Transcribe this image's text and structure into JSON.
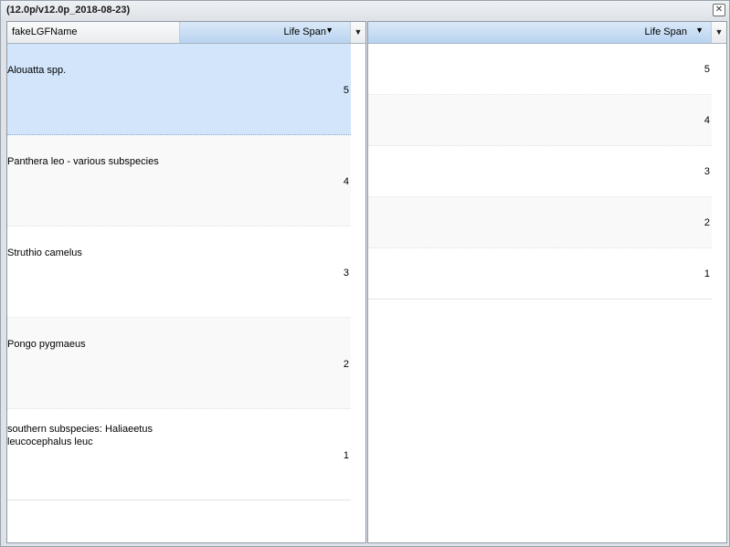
{
  "window": {
    "title": "(12.0p/v12.0p_2018-08-23)"
  },
  "icons": {
    "close": "close-icon",
    "sort": "sort-desc-icon",
    "menu": "dropdown-icon"
  },
  "left_grid": {
    "columns": [
      {
        "label": "fakeLGFName",
        "sorted": false
      },
      {
        "label": "Life Span",
        "sorted": true
      }
    ],
    "rows": [
      {
        "name": "Alouatta spp.",
        "life_span": "5",
        "selected": true
      },
      {
        "name": "Panthera leo - various subspecies",
        "life_span": "4",
        "selected": false
      },
      {
        "name": "Struthio camelus",
        "life_span": "3",
        "selected": false
      },
      {
        "name": "Pongo pygmaeus",
        "life_span": "2",
        "selected": false
      },
      {
        "name": "southern subspecies: Haliaeetus leucocephalus leuc",
        "life_span": "1",
        "selected": false
      }
    ]
  },
  "right_grid": {
    "columns": [
      {
        "label": "Life Span",
        "sorted": true
      }
    ],
    "rows": [
      {
        "life_span": "5"
      },
      {
        "life_span": "4"
      },
      {
        "life_span": "3"
      },
      {
        "life_span": "2"
      },
      {
        "life_span": "1"
      }
    ]
  },
  "colors": {
    "selected_row": "#d2e5fb",
    "sorted_header": "#b8d3f0"
  }
}
